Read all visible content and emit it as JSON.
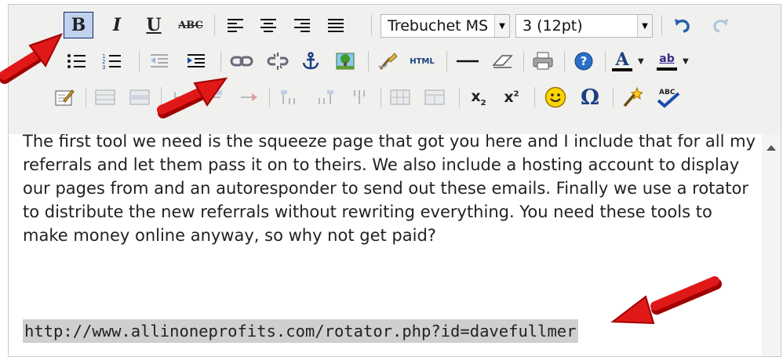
{
  "toolbar": {
    "bold_label": "B",
    "italic_label": "I",
    "underline_label": "U",
    "strike_label": "ABC",
    "font_name": "Trebuchet MS",
    "font_size": "3 (12pt)",
    "html_label": "HTML",
    "spell_label": "ABC",
    "omega_label": "Ω",
    "ab_label": "ab",
    "sub_label": "x",
    "sub_digit": "2",
    "sup_label": "x",
    "sup_digit": "2",
    "a_label": "A"
  },
  "content": {
    "paragraph": "The first tool we need is the squeeze page that got you here and I include that for all my referrals and let them pass it on to theirs. We also include a hosting account to display our pages from and an autoresponder to send out these emails. Finally we use a rotator to distribute the new referrals without rewriting everything. You need these tools to make money online anyway, so why not get paid?",
    "link": "http://www.allinoneprofits.com/rotator.php?id=davefullmer"
  },
  "colors": {
    "toolbar_bg": "#f0f0ee",
    "arrow_red": "#e01818",
    "link_highlight": "#cfcfcf"
  }
}
